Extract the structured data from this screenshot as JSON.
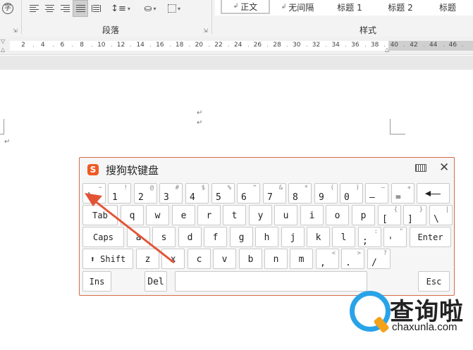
{
  "ribbon": {
    "paragraph_group_label": "段落",
    "styles_group_label": "样式",
    "styles": [
      "正文",
      "无间隔",
      "标题 1",
      "标题 2",
      "标题"
    ],
    "style_marks": [
      "↲",
      "↲",
      "",
      "",
      ""
    ],
    "char_icon": "字"
  },
  "ruler": {
    "ticks": [
      "2",
      "4",
      "6",
      "8",
      "10",
      "12",
      "14",
      "16",
      "18",
      "20",
      "22",
      "24",
      "26",
      "28",
      "30",
      "32",
      "34",
      "36",
      "38",
      "40",
      "42",
      "44",
      "46"
    ]
  },
  "document": {
    "paragraph_mark": "↵"
  },
  "keyboard": {
    "title": "搜狗软键盘",
    "logo": "S",
    "rows": [
      [
        {
          "main": "`",
          "shift": "~"
        },
        {
          "main": "1",
          "shift": "!"
        },
        {
          "main": "2",
          "shift": "@"
        },
        {
          "main": "3",
          "shift": "#"
        },
        {
          "main": "4",
          "shift": "$"
        },
        {
          "main": "5",
          "shift": "%"
        },
        {
          "main": "6",
          "shift": "^"
        },
        {
          "main": "7",
          "shift": "&"
        },
        {
          "main": "8",
          "shift": "*"
        },
        {
          "main": "9",
          "shift": "("
        },
        {
          "main": "0",
          "shift": ")"
        },
        {
          "main": "–",
          "shift": "—"
        },
        {
          "main": "=",
          "shift": "+"
        },
        {
          "main": "",
          "shift": "",
          "name": "backspace"
        }
      ],
      [
        {
          "main": "Tab",
          "shift": ""
        },
        {
          "main": "q",
          "shift": ""
        },
        {
          "main": "w",
          "shift": ""
        },
        {
          "main": "e",
          "shift": ""
        },
        {
          "main": "r",
          "shift": ""
        },
        {
          "main": "t",
          "shift": ""
        },
        {
          "main": "y",
          "shift": ""
        },
        {
          "main": "u",
          "shift": ""
        },
        {
          "main": "i",
          "shift": ""
        },
        {
          "main": "o",
          "shift": ""
        },
        {
          "main": "p",
          "shift": ""
        },
        {
          "main": "[",
          "shift": "{"
        },
        {
          "main": "]",
          "shift": "}"
        },
        {
          "main": "\\",
          "shift": "|"
        }
      ],
      [
        {
          "main": "Caps",
          "shift": ""
        },
        {
          "main": "a",
          "shift": ""
        },
        {
          "main": "s",
          "shift": ""
        },
        {
          "main": "d",
          "shift": ""
        },
        {
          "main": "f",
          "shift": ""
        },
        {
          "main": "g",
          "shift": ""
        },
        {
          "main": "h",
          "shift": ""
        },
        {
          "main": "j",
          "shift": ""
        },
        {
          "main": "k",
          "shift": ""
        },
        {
          "main": "l",
          "shift": ""
        },
        {
          "main": ";",
          "shift": ":"
        },
        {
          "main": "'",
          "shift": "\""
        },
        {
          "main": "Enter",
          "shift": ""
        }
      ],
      [
        {
          "main": "⬆ Shift",
          "shift": ""
        },
        {
          "main": "z",
          "shift": ""
        },
        {
          "main": "x",
          "shift": ""
        },
        {
          "main": "c",
          "shift": ""
        },
        {
          "main": "v",
          "shift": ""
        },
        {
          "main": "b",
          "shift": ""
        },
        {
          "main": "n",
          "shift": ""
        },
        {
          "main": "m",
          "shift": ""
        },
        {
          "main": ",",
          "shift": "<"
        },
        {
          "main": ".",
          "shift": ">"
        },
        {
          "main": "/",
          "shift": "?"
        }
      ],
      [
        {
          "main": "Ins",
          "shift": ""
        },
        {
          "main": "Del",
          "shift": ""
        },
        {
          "main": "",
          "shift": "",
          "name": "space"
        },
        {
          "main": "Esc",
          "shift": ""
        }
      ]
    ]
  },
  "watermark": {
    "name": "查询啦",
    "domain": "chaxunla.com"
  },
  "colors": {
    "accent": "#e35336",
    "keyboard_border": "#d46b4a",
    "watermark_blue": "#29a3e8",
    "watermark_orange": "#f3a21b"
  }
}
